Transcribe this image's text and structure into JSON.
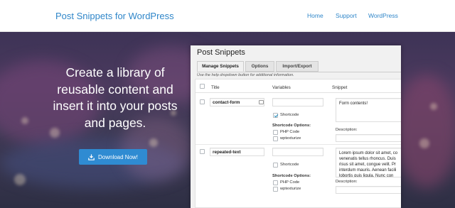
{
  "header": {
    "brand": "Post Snippets for WordPress",
    "nav": [
      "Home",
      "Support",
      "WordPress"
    ]
  },
  "hero": {
    "headline": "Create a library of reusable content and insert it into your posts and pages.",
    "download_label": "Download Now!"
  },
  "plugin": {
    "title": "Post Snippets",
    "tabs": [
      "Manage Snippets",
      "Options",
      "Import/Export"
    ],
    "active_tab": "Manage Snippets",
    "help_text": "Use the help dropdown button for additional information.",
    "columns": [
      "Title",
      "Variables",
      "Snippet"
    ],
    "rows": [
      {
        "title": "contact-form",
        "variables": "",
        "shortcode_checked": true,
        "shortcode_label": "Shortcode",
        "options_label": "Shortcode Options:",
        "php_label": "PHP Code",
        "wptexturize_label": "wptexturize",
        "snippet": "Form contents!",
        "description_label": "Description:"
      },
      {
        "title": "repeated-text",
        "variables": "",
        "shortcode_checked": false,
        "shortcode_label": "Shortcode",
        "options_label": "Shortcode Options:",
        "php_label": "PHP Code",
        "wptexturize_label": "wptexturize",
        "snippet": "Lorem ipsum dolor sit amet, co venenatis tellus rhoncus. Duis risus sit amet, congue velit. Pr interdum mauris. Aenean facili lobortis quis ligula. Nunc con",
        "description_label": "Description:"
      }
    ]
  },
  "colors": {
    "accent": "#2f86c9",
    "button": "#2f8bd2"
  },
  "icons": [
    "download-icon",
    "shortcode-icon"
  ]
}
